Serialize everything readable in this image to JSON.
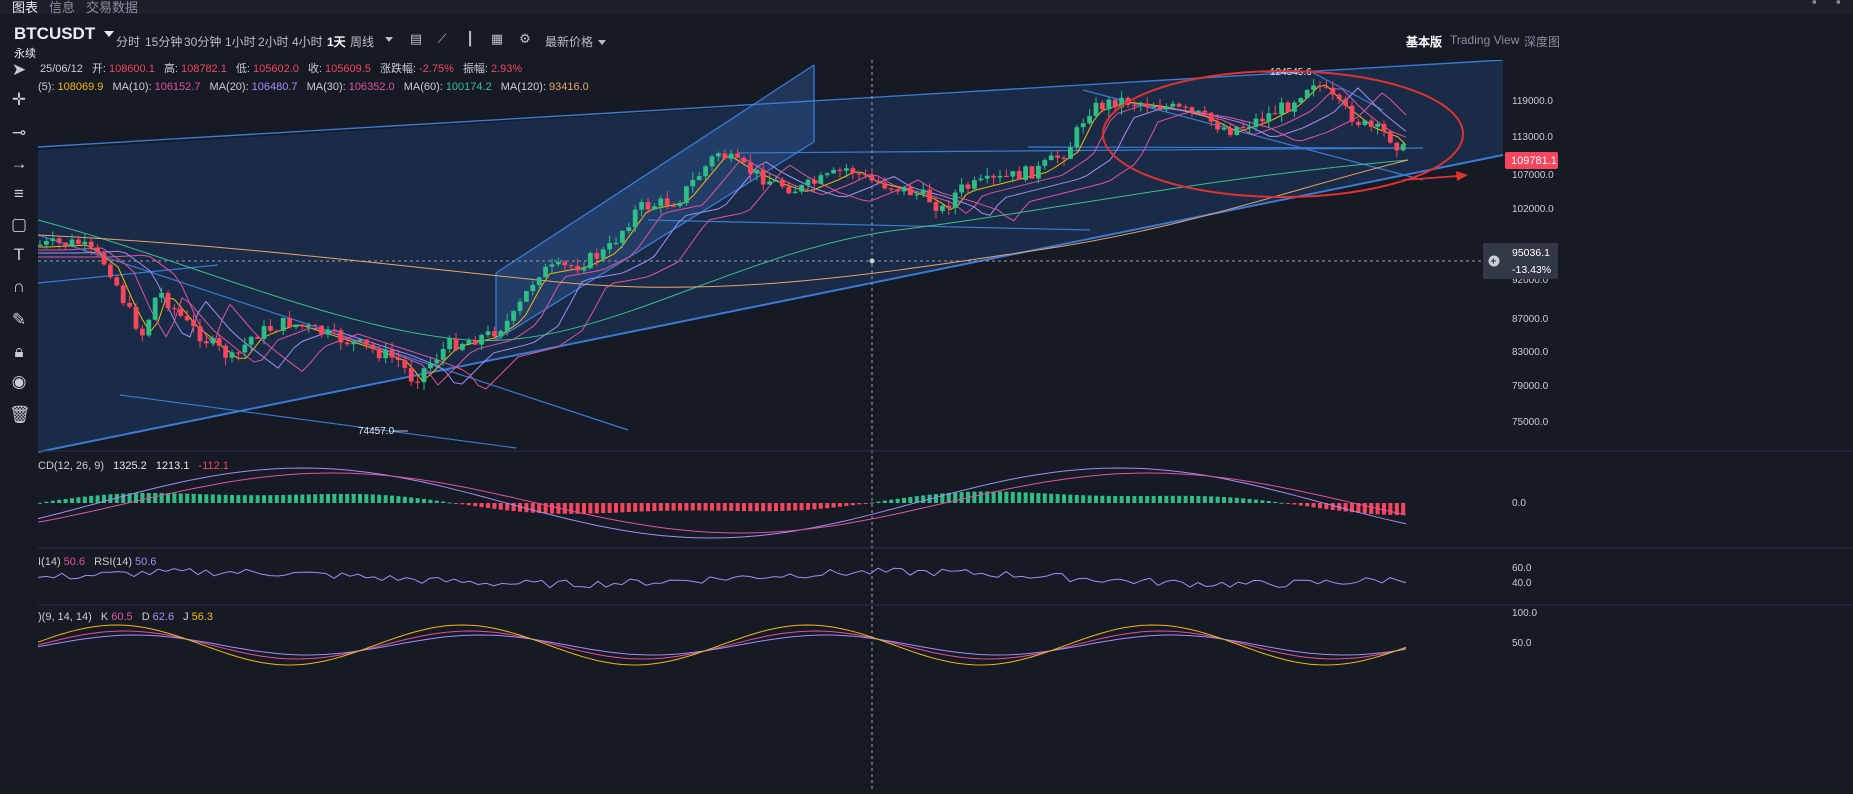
{
  "top_tabs": [
    "图表",
    "信息",
    "交易数据"
  ],
  "symbol": {
    "name": "BTCUSDT",
    "subtitle": "永续"
  },
  "timeframes": [
    {
      "label": "分时",
      "active": false
    },
    {
      "label": "15分钟",
      "active": false
    },
    {
      "label": "30分钟",
      "active": false
    },
    {
      "label": "1小时",
      "active": false
    },
    {
      "label": "2小时",
      "active": false
    },
    {
      "label": "4小时",
      "active": false
    },
    {
      "label": "1天",
      "active": true
    },
    {
      "label": "周线",
      "active": false
    }
  ],
  "price_type_label": "最新价格",
  "views": [
    {
      "label": "基本版",
      "active": true
    },
    {
      "label": "Trading View",
      "active": false
    },
    {
      "label": "深度图",
      "active": false
    }
  ],
  "ohlc": {
    "date": "25/06/12",
    "open_label": "开:",
    "open": "108600.1",
    "high_label": "高:",
    "high": "108782.1",
    "low_label": "低:",
    "low": "105602.0",
    "close_label": "收:",
    "close": "105609.5",
    "change_label": "涨跌幅:",
    "change": "-2.75%",
    "amplitude_label": "振幅:",
    "amplitude": "2.93%"
  },
  "ma_legend": [
    {
      "label": "(5):",
      "value": "108069.9",
      "color": "#f0b90b"
    },
    {
      "label": "MA(10):",
      "value": "106152.7",
      "color": "#e0529c"
    },
    {
      "label": "MA(20):",
      "value": "106480.7",
      "color": "#a58cf5"
    },
    {
      "label": "MA(30):",
      "value": "106352.0",
      "color": "#e0529c"
    },
    {
      "label": "MA(60):",
      "value": "100174.2",
      "color": "#3dbd8d"
    },
    {
      "label": "MA(120):",
      "value": "93416.0",
      "color": "#e9a36c"
    }
  ],
  "price_axis": [
    "119000.0",
    "113000.0",
    "107000.0",
    "102000.0",
    "92000.0",
    "87000.0",
    "83000.0",
    "79000.0",
    "75000.0"
  ],
  "current_price": "109781.1",
  "crosshair_price": "95036.1",
  "crosshair_pct": "-13.43%",
  "annotations": {
    "high": "124545.6",
    "low": "74457.0"
  },
  "macd_legend": {
    "label": "CD(12, 26, 9)",
    "dif": "1325.2",
    "dea": "1213.1",
    "hist": "-112.1"
  },
  "macd_axis": "0.0",
  "rsi_legend": {
    "label": "I(14)",
    "v1": "50.6",
    "label2": "RSI(14)",
    "v2": "50.6"
  },
  "rsi_axis": [
    "60.0",
    "40.0"
  ],
  "kdj_legend": {
    "label": ")(9, 14, 14)",
    "k_label": "K",
    "k": "60.5",
    "d_label": "D",
    "d": "62.6",
    "j_label": "J",
    "j": "56.3"
  },
  "kdj_axis": [
    "100.0",
    "50.0"
  ],
  "colors": {
    "up": "#2ebd85",
    "down": "#f6465d",
    "accent": "#f0b90b",
    "trend": "#3a7bd5"
  }
}
